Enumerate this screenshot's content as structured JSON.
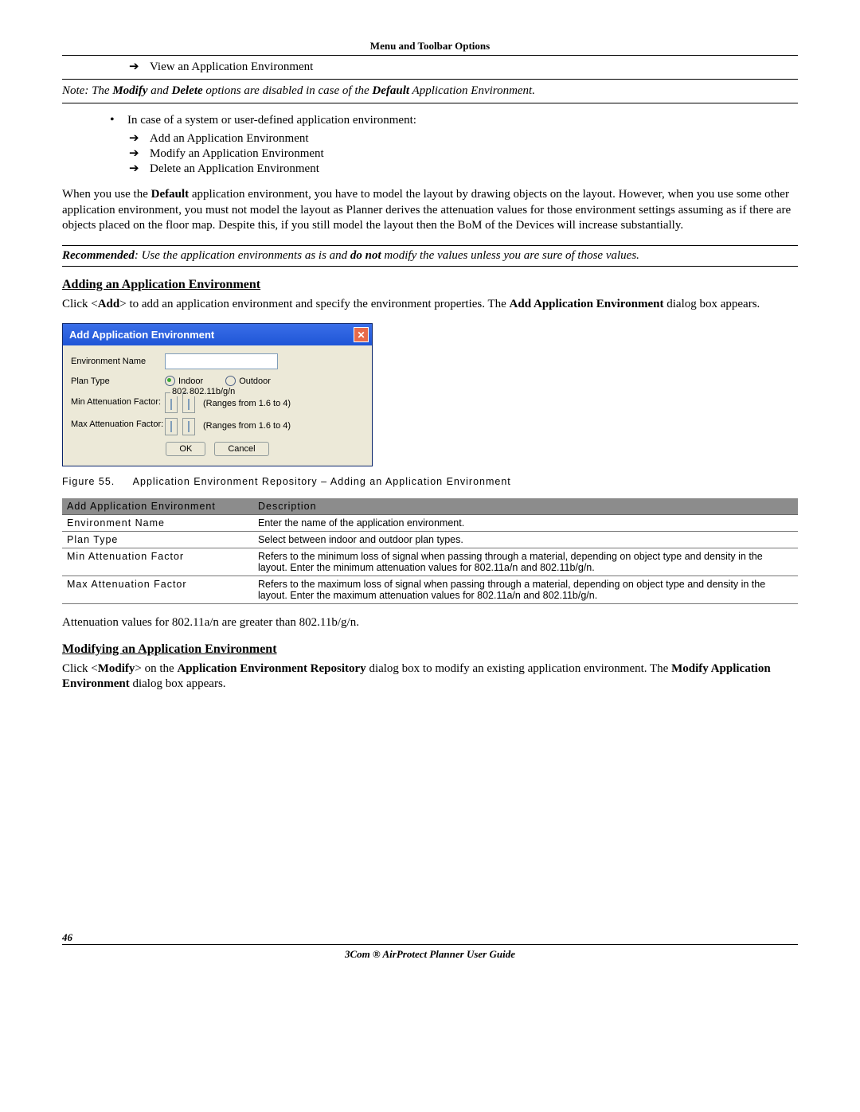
{
  "header": "Menu and Toolbar Options",
  "topList": [
    "View an Application Environment"
  ],
  "note1_pre": "Note: The ",
  "note1_b1": "Modify",
  "note1_mid": " and ",
  "note1_b2": "Delete",
  "note1_post": " options are disabled in case of the ",
  "note1_b3": "Default",
  "note1_end": " Application Environment.",
  "bulletIntro": "In case of a system or user-defined application environment:",
  "subList": [
    "Add an Application Environment",
    "Modify an Application Environment",
    "Delete an Application Environment"
  ],
  "para1a": "When you use the ",
  "para1b": "Default",
  "para1c": " application environment, you have to model the layout by drawing objects on the layout. However, when you use some other application environment, you must not model the layout as Planner derives the attenuation values for those environment settings assuming as if there are objects placed on the floor map. Despite this, if you still model the layout then the BoM of the Devices will increase substantially.",
  "reco_a": "Recommended",
  "reco_b": ": Use the application environments as is and ",
  "reco_c": "do not",
  "reco_d": " modify the values unless you are sure of those values.",
  "sec1": "Adding an Application Environment",
  "sec1p_a": "Click <",
  "sec1p_b": "Add",
  "sec1p_c": "> to add an application environment and specify the environment properties. The ",
  "sec1p_d": "Add Application Environment",
  "sec1p_e": " dialog box appears.",
  "dialog": {
    "title": "Add Application Environment",
    "envName": "Environment Name",
    "planType": "Plan Type",
    "indoor": "Indoor",
    "outdoor": "Outdoor",
    "leg1": "802.11a/n",
    "leg2": "802.11b/g/n",
    "minAtt": "Min Attenuation Factor:",
    "maxAtt": "Max Attenuation Factor:",
    "range": "(Ranges from 1.6 to 4)",
    "ok": "OK",
    "cancel": "Cancel"
  },
  "figNum": "Figure 55.",
  "figCap": "Application Environment Repository – Adding an Application Environment",
  "table": {
    "h1": "Add Application Environment",
    "h2": "Description",
    "rows": [
      {
        "c1": "Environment Name",
        "c2": "Enter the name of the application environment."
      },
      {
        "c1": "Plan Type",
        "c2": "Select between indoor and outdoor plan types."
      },
      {
        "c1": "Min Attenuation Factor",
        "c2": "Refers to the minimum loss of signal when passing through a material, depending on object type and density in the layout. Enter the minimum attenuation values for 802.11a/n and 802.11b/g/n."
      },
      {
        "c1": "Max Attenuation Factor",
        "c2": "Refers to the maximum loss of signal when passing through a material, depending on object type and density in the layout. Enter the maximum attenuation values for 802.11a/n and 802.11b/g/n."
      }
    ]
  },
  "attNote": "Attenuation values for 802.11a/n are greater than 802.11b/g/n.",
  "sec2": "Modifying an Application Environment",
  "sec2p_a": "Click <",
  "sec2p_b": "Modify",
  "sec2p_c": "> on the ",
  "sec2p_d": "Application Environment Repository",
  "sec2p_e": " dialog box to modify an existing application environment. The ",
  "sec2p_f": "Modify Application Environment",
  "sec2p_g": " dialog box appears.",
  "pageNum": "46",
  "footer": "3Com ® AirProtect Planner User Guide"
}
